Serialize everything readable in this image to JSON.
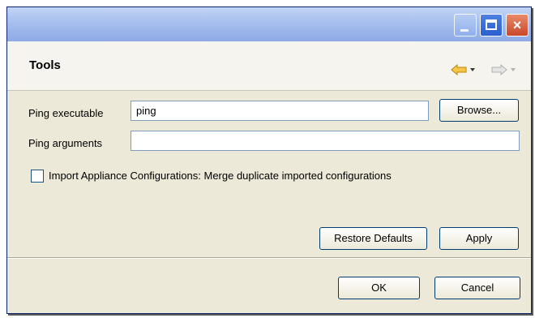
{
  "header": {
    "title": "Tools"
  },
  "form": {
    "ping_executable": {
      "label": "Ping executable",
      "value": "ping"
    },
    "ping_arguments": {
      "label": "Ping arguments",
      "value": ""
    },
    "browse_label": "Browse...",
    "merge_option": {
      "label": "Import Appliance Configurations: Merge duplicate imported configurations",
      "checked": false
    }
  },
  "actions": {
    "restore_defaults_label": "Restore Defaults",
    "apply_label": "Apply",
    "ok_label": "OK",
    "cancel_label": "Cancel"
  },
  "icons": {
    "close": "×",
    "back": "back-arrow-icon",
    "forward": "forward-arrow-icon",
    "dropdown": "dropdown-triangle-icon"
  },
  "colors": {
    "titlebar": "#a6bfee",
    "dialog_background": "#ece9d8",
    "back_arrow": "#e8a317",
    "forward_arrow": "#c0c0c0"
  }
}
